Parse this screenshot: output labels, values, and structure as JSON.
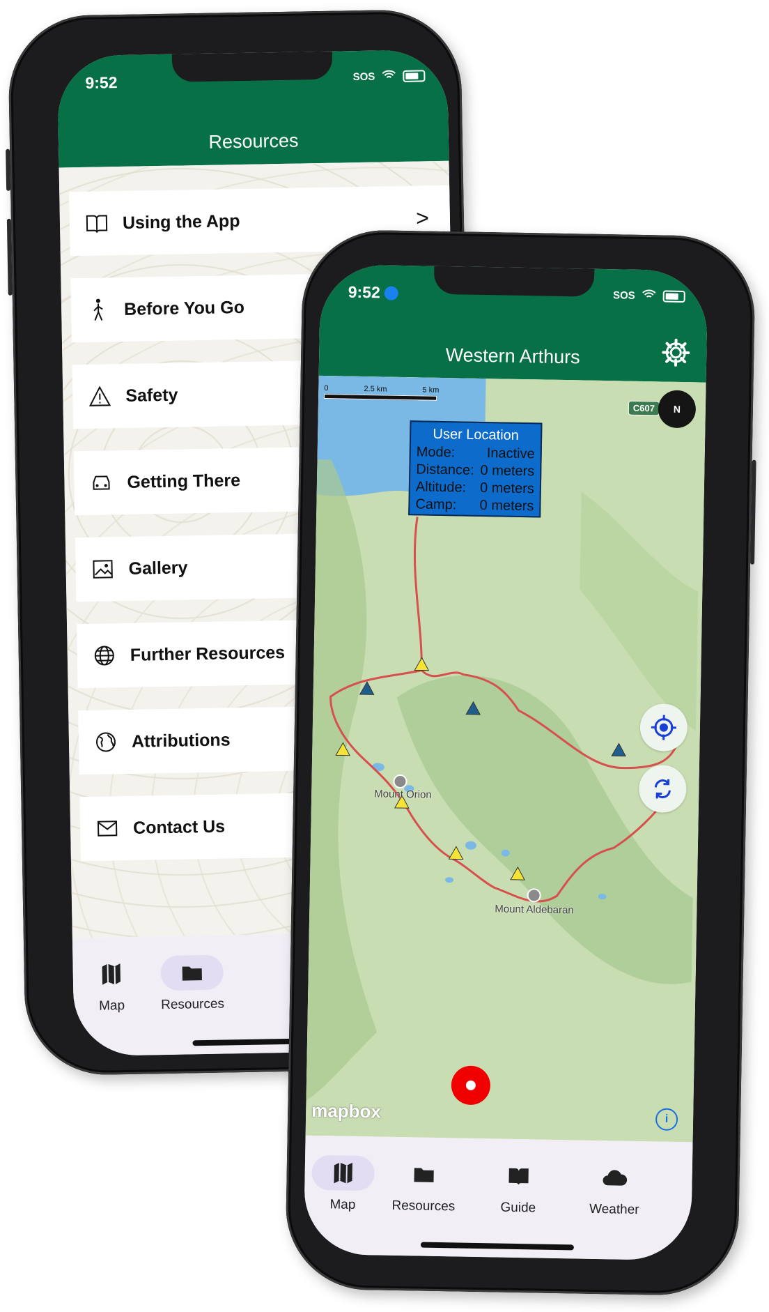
{
  "back_phone": {
    "status": {
      "time": "9:52",
      "sos": "SOS"
    },
    "header_title": "Resources",
    "list_items": [
      {
        "label": "Using the App",
        "icon": "book-icon",
        "chevron": ">"
      },
      {
        "label": "Before You Go",
        "icon": "hiker-icon"
      },
      {
        "label": "Safety",
        "icon": "warning-icon"
      },
      {
        "label": "Getting There",
        "icon": "car-icon"
      },
      {
        "label": "Gallery",
        "icon": "image-icon"
      },
      {
        "label": "Further Resources",
        "icon": "globe-icon"
      },
      {
        "label": "Attributions",
        "icon": "earth-icon"
      },
      {
        "label": "Contact Us",
        "icon": "envelope-icon"
      }
    ],
    "tabs": [
      {
        "label": "Map",
        "icon": "map-icon"
      },
      {
        "label": "Resources",
        "icon": "folder-icon",
        "active": true
      }
    ]
  },
  "front_phone": {
    "status": {
      "time": "9:52",
      "sos": "SOS"
    },
    "header_title": "Western Arthurs",
    "map": {
      "scale_labels": [
        "0",
        "2.5 km",
        "5 km"
      ],
      "road_label": "C607",
      "compass_label": "N",
      "info_box": {
        "title": "User Location",
        "rows": [
          {
            "key": "Mode:",
            "value": "Inactive"
          },
          {
            "key": "Distance:",
            "value": "0 meters"
          },
          {
            "key": "Altitude:",
            "value": "0 meters"
          },
          {
            "key": "Camp:",
            "value": "0 meters"
          }
        ]
      },
      "peaks": [
        "Mount Orion",
        "Mount Aldebaran"
      ],
      "attribution": "mapbox",
      "info_button": "i"
    },
    "tabs": [
      {
        "label": "Map",
        "icon": "map-icon",
        "active": true
      },
      {
        "label": "Resources",
        "icon": "folder-icon"
      },
      {
        "label": "Guide",
        "icon": "book-icon"
      },
      {
        "label": "Weather",
        "icon": "cloud-icon"
      }
    ]
  },
  "colors": {
    "header_green": "#077046",
    "track_red": "#d6504e",
    "lake_blue": "#7ab8e6",
    "record_red": "#f00000",
    "tab_bg": "#f1eef6",
    "active_pill": "#e3ddf4"
  }
}
